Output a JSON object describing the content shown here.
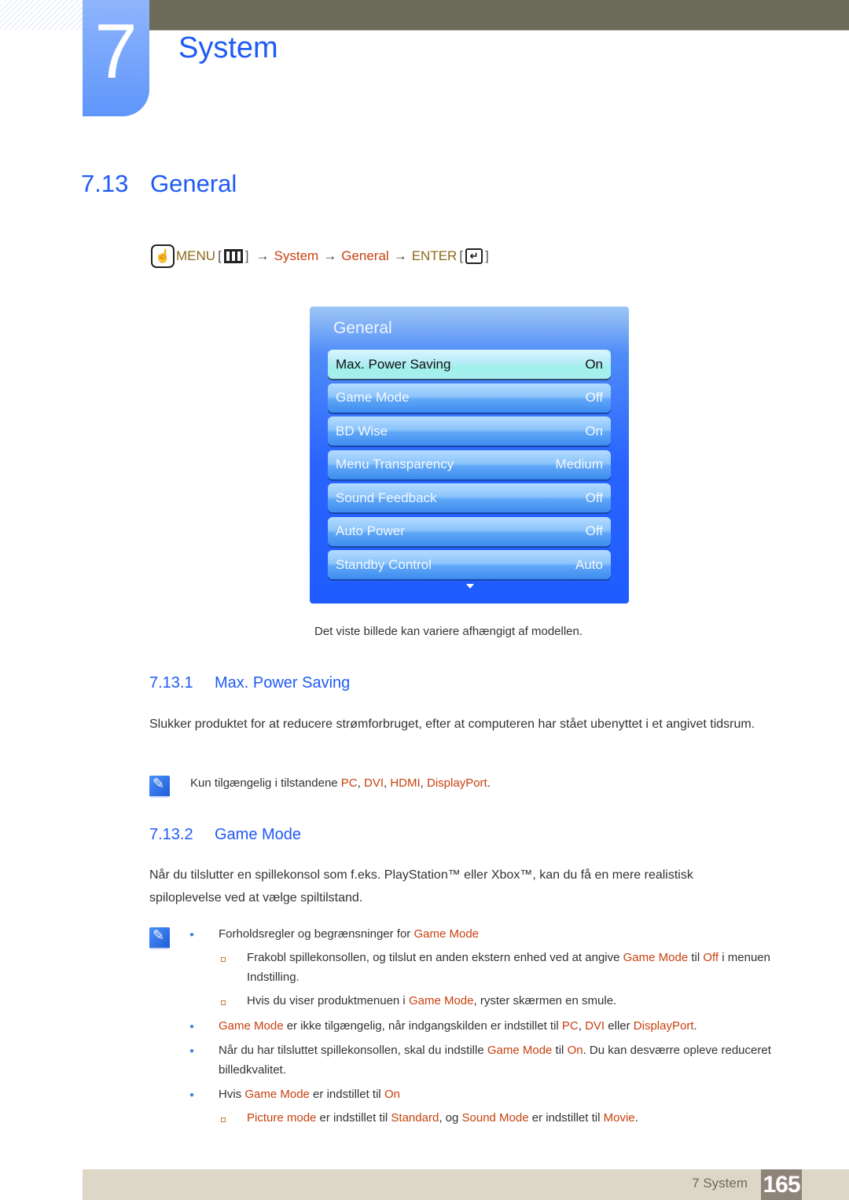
{
  "chapter": {
    "number": "7",
    "title": "System"
  },
  "section": {
    "number": "7.13",
    "title": "General"
  },
  "menu_path": {
    "menu": "MENU",
    "system": "System",
    "general": "General",
    "enter": "ENTER",
    "arrow": "→",
    "bracket_open": "[",
    "bracket_close": "]",
    "enter_glyph": "↵",
    "hand_glyph": "☝"
  },
  "osd": {
    "title": "General",
    "items": [
      {
        "label": "Max. Power Saving",
        "value": "On",
        "selected": true
      },
      {
        "label": "Game Mode",
        "value": "Off"
      },
      {
        "label": "BD Wise",
        "value": "On"
      },
      {
        "label": "Menu Transparency",
        "value": "Medium"
      },
      {
        "label": "Sound Feedback",
        "value": "Off"
      },
      {
        "label": "Auto Power",
        "value": "Off"
      },
      {
        "label": "Standby Control",
        "value": "Auto"
      }
    ]
  },
  "caption": "Det viste billede kan variere afhængigt af modellen.",
  "sub1": {
    "number": "7.13.1",
    "title": "Max. Power Saving",
    "body": "Slukker produktet for at reducere strømforbruget, efter at computeren har stået ubenyttet i et angivet tidsrum.",
    "note": {
      "prefix": "Kun tilgængelig i tilstandene ",
      "pc": "PC",
      "dvi": "DVI",
      "hdmi": "HDMI",
      "dp": "DisplayPort",
      "sep": ", ",
      "end": "."
    }
  },
  "sub2": {
    "number": "7.13.2",
    "title": "Game Mode",
    "body": "Når du tilslutter en spillekonsol som f.eks. PlayStation™ eller Xbox™, kan du få en mere realistisk spiloplevelse ved at vælge spiltilstand.",
    "b1": {
      "text": "Forholdsregler og begrænsninger for ",
      "hl": "Game Mode"
    },
    "b1s1": {
      "t1": "Frakobl spillekonsollen, og tilslut en anden ekstern enhed ved at angive ",
      "hl1": "Game Mode",
      "t2": " til ",
      "hl2": "Off",
      "t3": " i menuen Indstilling."
    },
    "b1s2": {
      "t1": "Hvis du viser produktmenuen i ",
      "hl1": "Game Mode",
      "t2": ", ryster skærmen en smule."
    },
    "b2": {
      "hl1": "Game Mode",
      "t1": " er ikke tilgængelig, når indgangskilden er indstillet til ",
      "hl2": "PC",
      "t2": ", ",
      "hl3": "DVI",
      "t3": " eller ",
      "hl4": "DisplayPort",
      "t4": "."
    },
    "b3": {
      "t1": "Når du har tilsluttet spillekonsollen, skal du indstille ",
      "hl1": "Game Mode",
      "t2": " til ",
      "hl2": "On",
      "t3": ". Du kan desværre opleve reduceret billedkvalitet."
    },
    "b4": {
      "t1": "Hvis ",
      "hl1": "Game Mode",
      "t2": " er indstillet til ",
      "hl2": "On"
    },
    "b4s1": {
      "hl1": "Picture mode",
      "t1": " er indstillet til ",
      "hl2": "Standard",
      "t2": ", og ",
      "hl3": "Sound Mode",
      "t3": " er indstillet til ",
      "hl4": "Movie",
      "t4": "."
    }
  },
  "footer": {
    "label": "7 System",
    "page": "165"
  }
}
